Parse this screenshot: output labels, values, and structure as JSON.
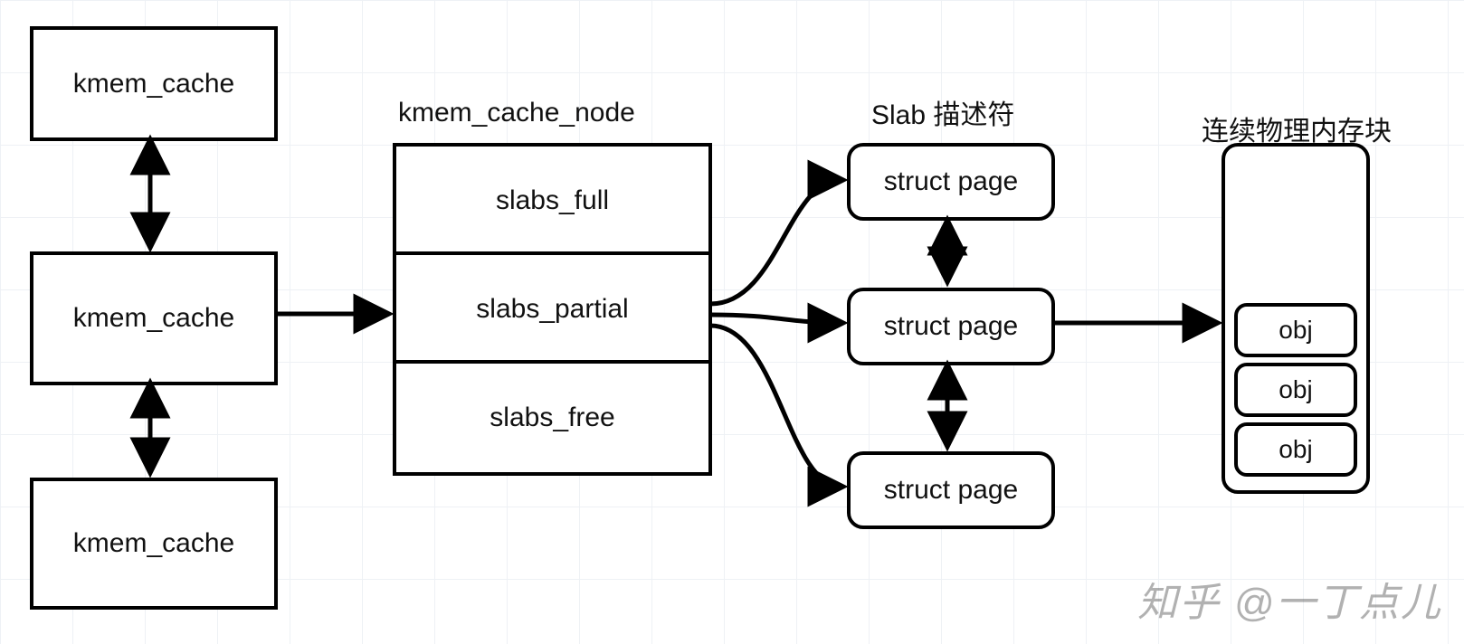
{
  "caches": {
    "top": "kmem_cache",
    "mid": "kmem_cache",
    "bottom": "kmem_cache"
  },
  "node": {
    "title": "kmem_cache_node",
    "rows": [
      "slabs_full",
      "slabs_partial",
      "slabs_free"
    ]
  },
  "slab": {
    "title": "Slab 描述符",
    "pages": [
      "struct page",
      "struct page",
      "struct page"
    ]
  },
  "memblock": {
    "title": "连续物理内存块",
    "objs": [
      "obj",
      "obj",
      "obj"
    ]
  },
  "watermark": "知乎 @一丁点儿"
}
